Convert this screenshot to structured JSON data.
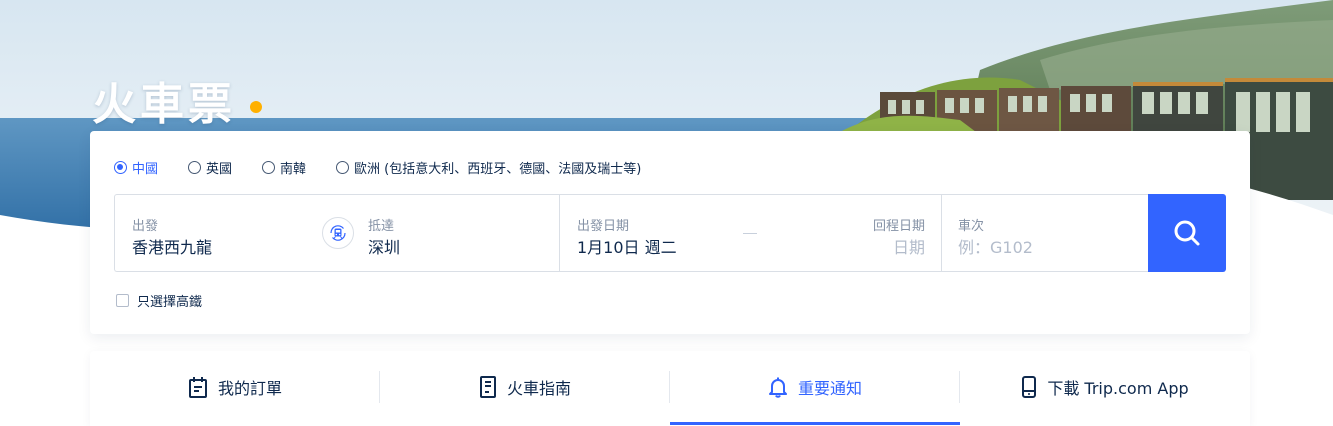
{
  "page": {
    "title": "火車票",
    "accent_color": "#3264ff",
    "dot_color": "#ffb000"
  },
  "regions": [
    {
      "label": "中國",
      "selected": true
    },
    {
      "label": "英國",
      "selected": false
    },
    {
      "label": "南韓",
      "selected": false
    },
    {
      "label": "歐洲 (包括意大利、西班牙、德國、法國及瑞士等)",
      "selected": false
    }
  ],
  "search": {
    "from_label": "出發",
    "from_value": "香港西九龍",
    "to_label": "抵達",
    "to_value": "深圳",
    "swap_icon": "train-swap-icon",
    "depart_label": "出發日期",
    "depart_value": "1月10日 週二",
    "return_label": "回程日期",
    "return_placeholder": "日期",
    "train_no_label": "車次",
    "train_no_placeholder": "例：G102",
    "search_icon": "search-icon"
  },
  "filters": {
    "high_speed_label": "只選擇高鐵",
    "high_speed_checked": false
  },
  "tabs": [
    {
      "label": "我的訂單",
      "icon": "clipboard-icon",
      "active": false
    },
    {
      "label": "火車指南",
      "icon": "guide-book-icon",
      "active": false
    },
    {
      "label": "重要通知",
      "icon": "bell-icon",
      "active": true
    },
    {
      "label": "下載 Trip.com App",
      "icon": "phone-icon",
      "active": false
    }
  ]
}
